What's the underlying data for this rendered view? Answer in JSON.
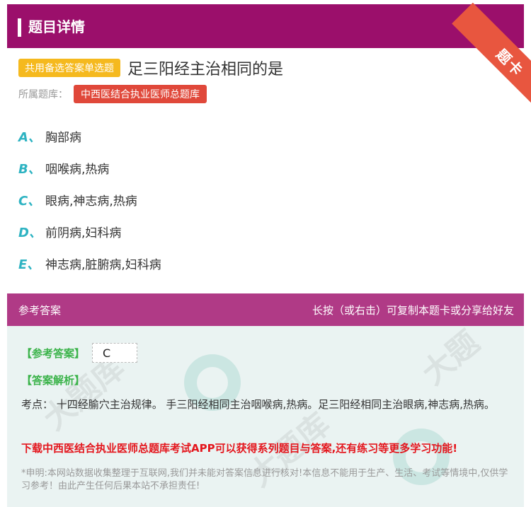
{
  "header": {
    "title": "题目详情",
    "corner_badge": "题卡"
  },
  "question": {
    "type_badge": "共用备选答案单选题",
    "text": "足三阳经主治相同的是",
    "bank_label": "所属题库：",
    "bank_name": "中西医结合执业医师总题库"
  },
  "options": [
    {
      "letter": "A、",
      "text": "胸部病"
    },
    {
      "letter": "B、",
      "text": "咽喉病,热病"
    },
    {
      "letter": "C、",
      "text": "眼病,神志病,热病"
    },
    {
      "letter": "D、",
      "text": "前阴病,妇科病"
    },
    {
      "letter": "E、",
      "text": "神志病,脏腑病,妇科病"
    }
  ],
  "answer_section": {
    "title": "参考答案",
    "share_hint": "长按（或右击）可复制本题卡或分享给好友",
    "ref_label": "【参考答案】",
    "ref_value": "C",
    "analysis_label": "【答案解析】",
    "analysis_text": "考点： 十四经腧穴主治规律。 手三阳经相同主治咽喉病,热病。足三阳经相同主治眼病,神志病,热病。",
    "promo": "下载中西医结合执业医师总题库考试APP可以获得系列题目与答案,还有练习等更多学习功能!",
    "disclaimer": "*申明:本网站数据收集整理于互联网,我们并未能对答案信息进行核对!本信息不能用于生产、生活、考试等情境中,仅供学习参考！由此产生任何后果本站不承担责任!"
  },
  "colors": {
    "header_bg": "#9b0f6b",
    "answer_header_bg": "#b03a86",
    "badge_yellow": "#f5b91e",
    "bank_red": "#e0483a",
    "option_letter": "#2eb3c2",
    "green_label": "#3bb34a",
    "promo_red": "#e4161d"
  }
}
